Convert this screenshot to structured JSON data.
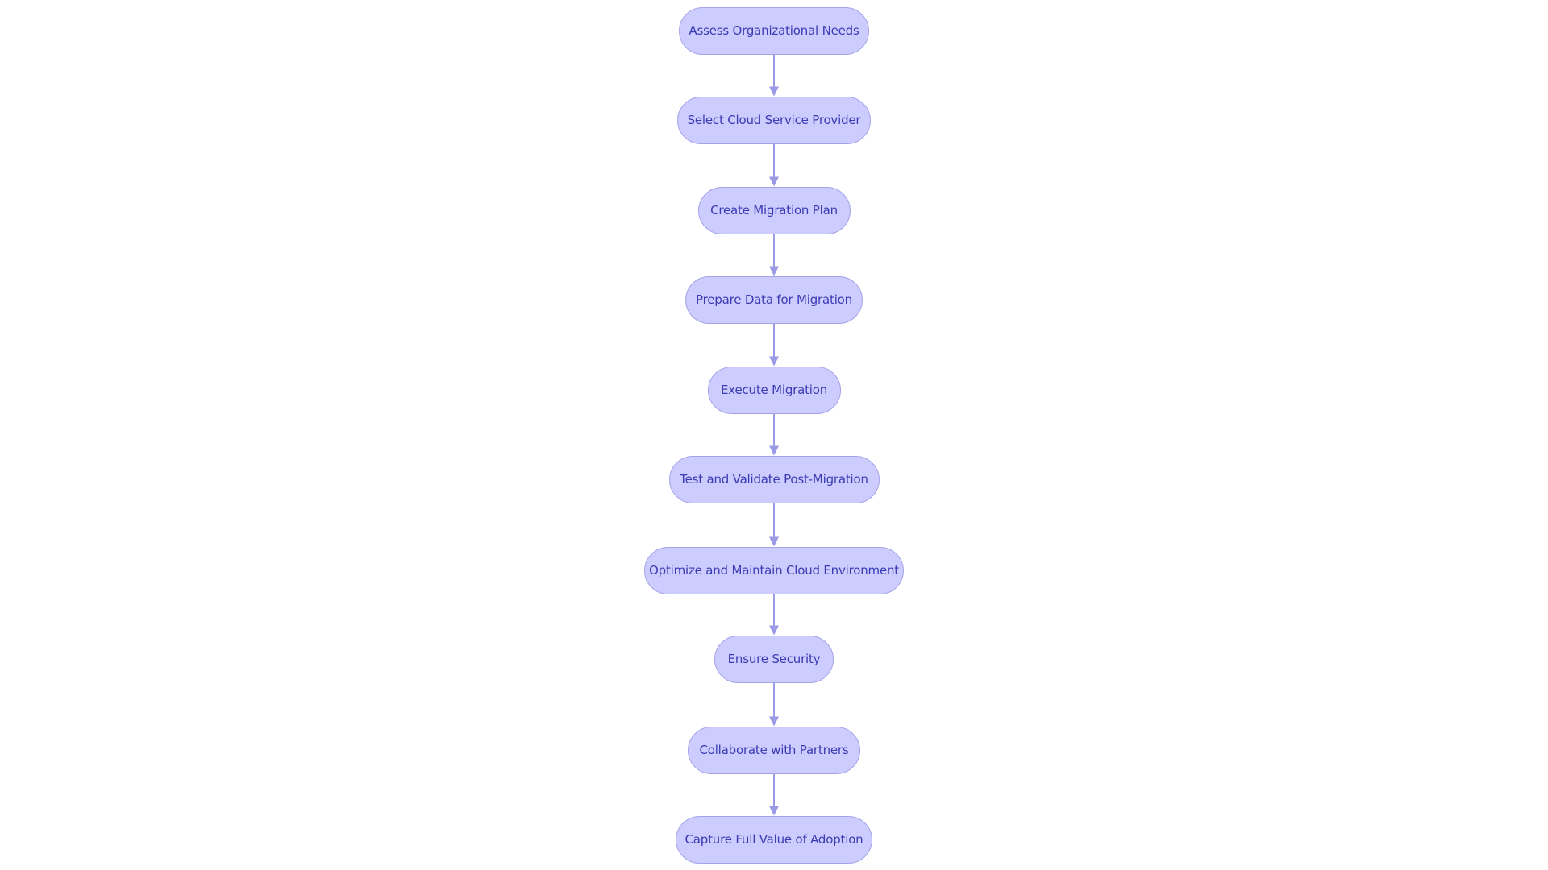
{
  "colors": {
    "node_fill": "#ccccff",
    "node_stroke": "#a3a3e8",
    "text": "#3b3bb3",
    "edge": "#9a9ae6"
  },
  "nodes": [
    {
      "label": "Assess Organizational Needs"
    },
    {
      "label": "Select Cloud Service Provider"
    },
    {
      "label": "Create Migration Plan"
    },
    {
      "label": "Prepare Data for Migration"
    },
    {
      "label": "Execute Migration"
    },
    {
      "label": "Test and Validate Post-Migration"
    },
    {
      "label": "Optimize and Maintain Cloud Environment"
    },
    {
      "label": "Ensure Security"
    },
    {
      "label": "Collaborate with Partners"
    },
    {
      "label": "Capture Full Value of Adoption"
    }
  ]
}
